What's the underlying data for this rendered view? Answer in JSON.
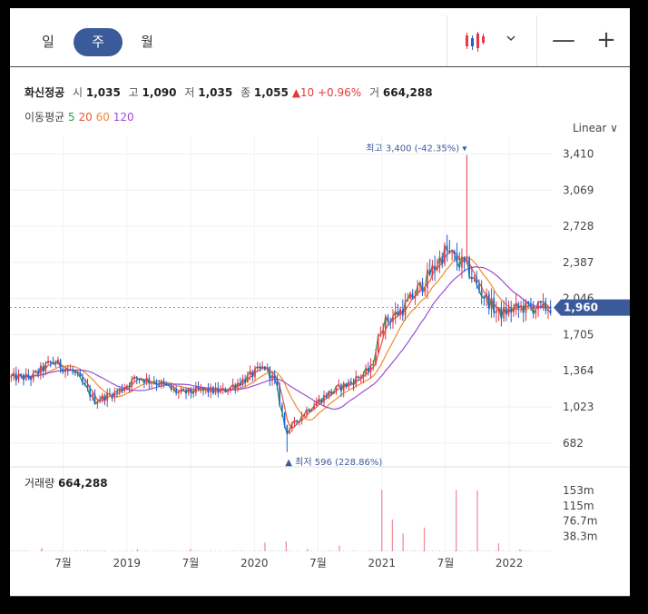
{
  "tabs": [
    {
      "label": "일"
    },
    {
      "label": "주"
    },
    {
      "label": "월"
    }
  ],
  "toolbar": {
    "chart_type_icon": "candle-icon",
    "chevron_icon": "chevron-down-icon",
    "zoom_out": "—",
    "zoom_in": "+"
  },
  "info": {
    "name": "화신정공",
    "open_label": "시",
    "open": "1,035",
    "high_label": "고",
    "high": "1,090",
    "low_label": "저",
    "low": "1,035",
    "close_label": "종",
    "close": "1,055",
    "change": "▲10 +0.96%",
    "volume_label": "거",
    "volume": "664,288"
  },
  "ma": {
    "label": "이동평균",
    "p5": "5",
    "p20": "20",
    "p60": "60",
    "p120": "120",
    "colors": {
      "p5": "#2e9e48",
      "p20": "#e8553a",
      "p60": "#f08b2a",
      "p120": "#9c4fd0"
    }
  },
  "scale_label": "Linear ∨",
  "volume_header": {
    "label": "거래량",
    "value": "664,288"
  },
  "colors": {
    "up": "#e3374b",
    "down": "#1f63d0",
    "accent": "#3a5a9a"
  },
  "chart_data": {
    "type": "candlestick",
    "ylim": [
      500,
      3500
    ],
    "yticks": [
      "3,410",
      "3,069",
      "2,728",
      "2,387",
      "2,046",
      "1,705",
      "1,364",
      "1,023",
      "682"
    ],
    "yticks_values": [
      3410,
      3069,
      2728,
      2387,
      2046,
      1705,
      1364,
      1023,
      682
    ],
    "xticks": [
      "7월",
      "2019",
      "7월",
      "2020",
      "7월",
      "2021",
      "7월",
      "2022"
    ],
    "current_price": "1,960",
    "current_value": 1960,
    "high_annotation": "최고 3,400 (-42.35%)",
    "low_annotation": "최저 596 (228.86%)",
    "volume_ticks": [
      "153m",
      "115m",
      "76.7m",
      "38.3m"
    ],
    "volume_ticks_values": [
      153,
      115,
      76.7,
      38.3
    ],
    "volume_max": 190,
    "timeline": [
      {
        "date": "2018-04",
        "price": 1300
      },
      {
        "date": "2018-06",
        "price": 1450
      },
      {
        "date": "2018-08",
        "price": 1350
      },
      {
        "date": "2018-10",
        "price": 1080
      },
      {
        "date": "2018-12",
        "price": 1160
      },
      {
        "date": "2019-02",
        "price": 1300
      },
      {
        "date": "2019-04",
        "price": 1250
      },
      {
        "date": "2019-06",
        "price": 1150
      },
      {
        "date": "2019-08",
        "price": 1180
      },
      {
        "date": "2019-10",
        "price": 1170
      },
      {
        "date": "2019-12",
        "price": 1280
      },
      {
        "date": "2020-02",
        "price": 1400
      },
      {
        "date": "2020-03",
        "price": 1250
      },
      {
        "date": "2020-04",
        "price": 780
      },
      {
        "date": "2020-06",
        "price": 1000
      },
      {
        "date": "2020-08",
        "price": 1150
      },
      {
        "date": "2020-10",
        "price": 1250
      },
      {
        "date": "2020-12",
        "price": 1380
      },
      {
        "date": "2021-01",
        "price": 1800
      },
      {
        "date": "2021-03",
        "price": 1950
      },
      {
        "date": "2021-05",
        "price": 2200
      },
      {
        "date": "2021-07",
        "price": 2500
      },
      {
        "date": "2021-08",
        "price": 2400
      },
      {
        "date": "2021-09",
        "price": 2350
      },
      {
        "date": "2021-10",
        "price": 2150
      },
      {
        "date": "2021-12",
        "price": 1900
      },
      {
        "date": "2022-02",
        "price": 1960
      }
    ],
    "volume_spikes": [
      {
        "date": "2018-05",
        "value": 8
      },
      {
        "date": "2019-02",
        "value": 5
      },
      {
        "date": "2019-07",
        "value": 6
      },
      {
        "date": "2020-02",
        "value": 22
      },
      {
        "date": "2020-04",
        "value": 25
      },
      {
        "date": "2020-06",
        "value": 6
      },
      {
        "date": "2020-09",
        "value": 15
      },
      {
        "date": "2021-01",
        "value": 155
      },
      {
        "date": "2021-02",
        "value": 80
      },
      {
        "date": "2021-03",
        "value": 45
      },
      {
        "date": "2021-05",
        "value": 60
      },
      {
        "date": "2021-08",
        "value": 155
      },
      {
        "date": "2021-10",
        "value": 153
      },
      {
        "date": "2021-12",
        "value": 20
      },
      {
        "date": "2022-02",
        "value": 5
      }
    ],
    "series": [
      {
        "name": "5"
      },
      {
        "name": "20"
      },
      {
        "name": "60"
      },
      {
        "name": "120"
      }
    ]
  }
}
